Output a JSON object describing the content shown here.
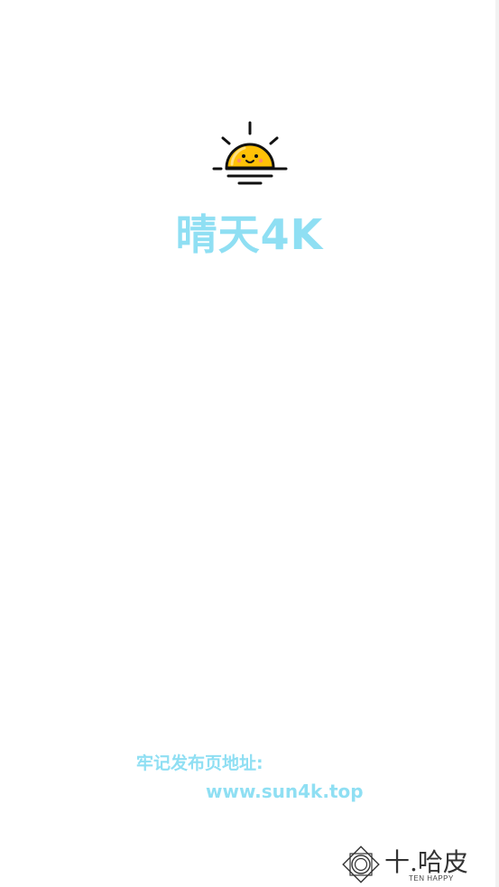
{
  "app": {
    "name": "晴天4K"
  },
  "notice": {
    "label": "牢记发布页地址:",
    "url": "www.sun4k.top"
  },
  "brand": {
    "cn": "十.哈皮",
    "en": "TEN HAPPY"
  },
  "colors": {
    "accent": "#8fdff3",
    "sun": "#ffc107",
    "background": "#ffffff"
  },
  "icons": {
    "logo": "smiling-sun-icon",
    "brand": "diamond-circle-icon"
  }
}
